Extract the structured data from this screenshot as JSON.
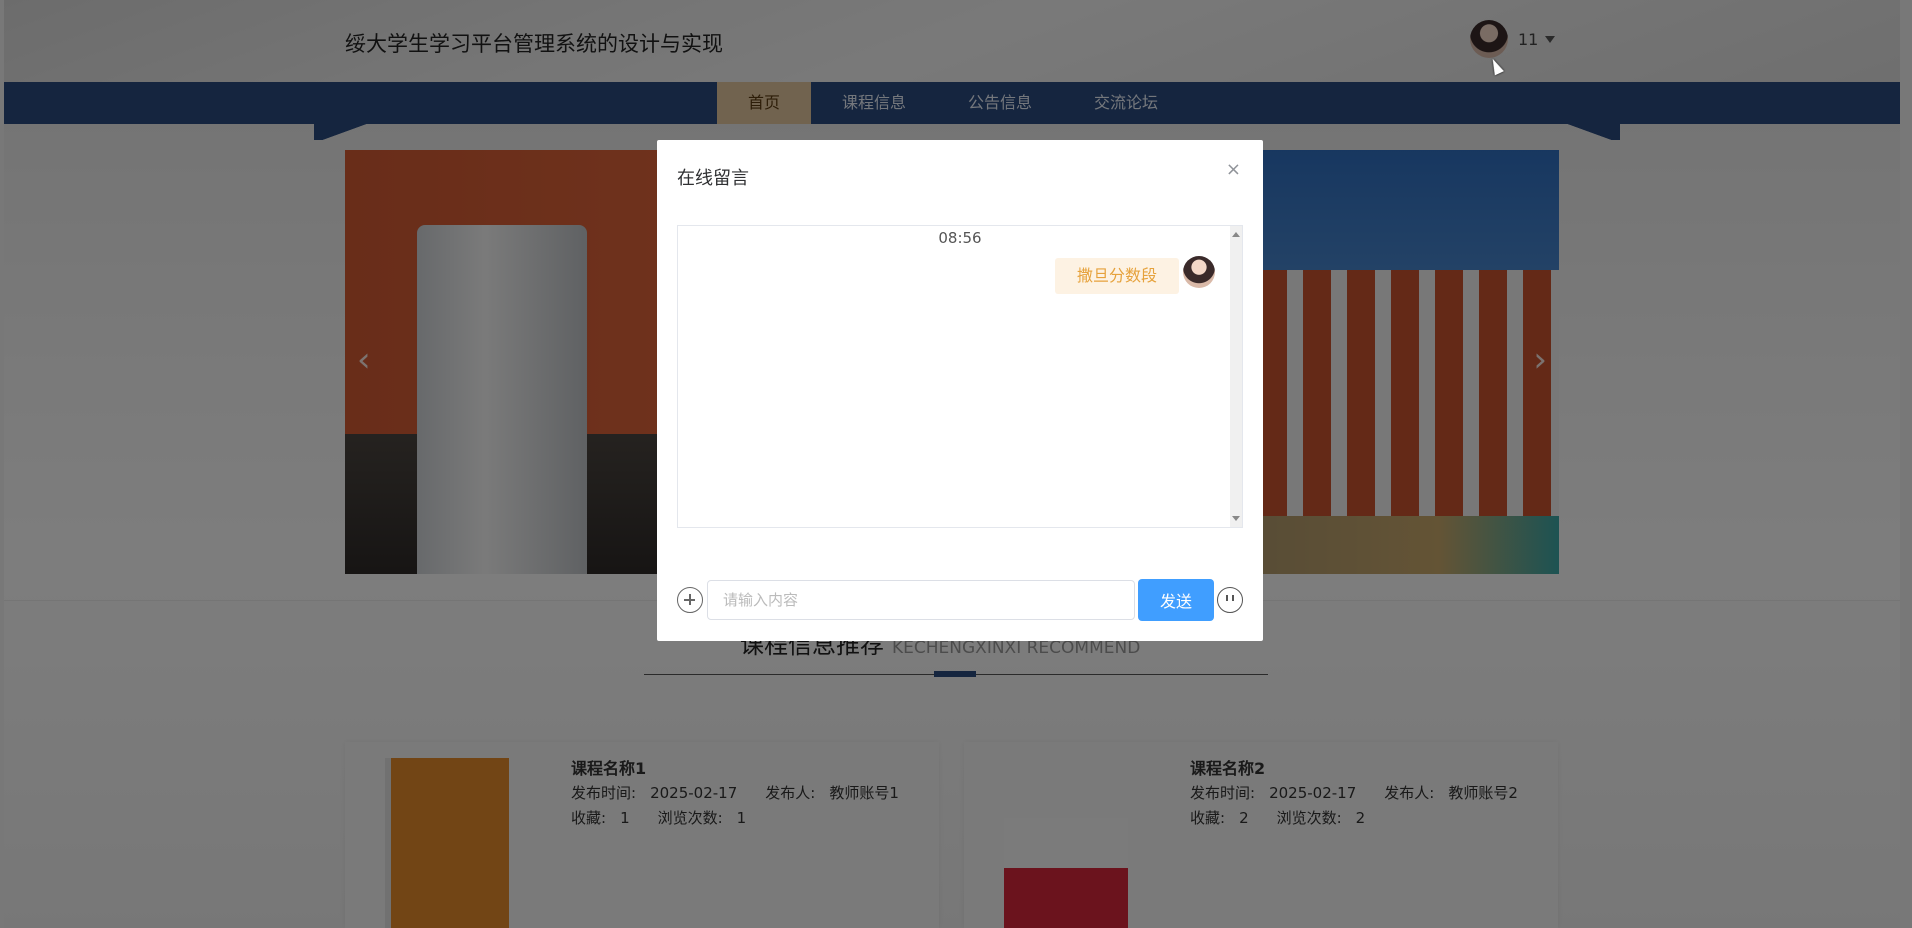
{
  "header": {
    "site_title": "绥大学生学习平台管理系统的设计与实现",
    "user_name": "11",
    "avatar_icon": "avatar-icon",
    "dropdown_icon": "caret-down-icon"
  },
  "nav": {
    "items": [
      {
        "label": "首页",
        "active": true
      },
      {
        "label": "课程信息",
        "active": false
      },
      {
        "label": "公告信息",
        "active": false
      },
      {
        "label": "交流论坛",
        "active": false
      }
    ]
  },
  "carousel": {
    "prev_icon": "chevron-left-icon",
    "next_icon": "chevron-right-icon",
    "prev_glyph": "‹",
    "next_glyph": "›"
  },
  "section": {
    "title": "课程信息推荐",
    "subtitle_en": "KECHENGXINXI RECOMMEND"
  },
  "courses": [
    {
      "name": "课程名称1",
      "publish_label": "发布时间:",
      "publish_time": "2025-02-17",
      "publisher_label": "发布人:",
      "publisher": "教师账号1",
      "fav_label": "收藏:",
      "fav": "1",
      "views_label": "浏览次数:",
      "views": "1"
    },
    {
      "name": "课程名称2",
      "publish_label": "发布时间:",
      "publish_time": "2025-02-17",
      "publisher_label": "发布人:",
      "publisher": "教师账号2",
      "fav_label": "收藏:",
      "fav": "2",
      "views_label": "浏览次数:",
      "views": "2"
    }
  ],
  "modal": {
    "title": "在线留言",
    "close_glyph": "×",
    "chat_time": "08:56",
    "messages": [
      {
        "text": "撒旦分数段",
        "from_self": true
      }
    ],
    "input_placeholder": "请输入内容",
    "input_value": "",
    "send_label": "发送",
    "attach_icon": "plus-circle-icon",
    "emoji_icon": "emoji-icon"
  },
  "colors": {
    "nav_bg": "#2b4a7e",
    "nav_active_bg": "#e2c79f",
    "send_button": "#409eff",
    "bubble_bg": "#fdf2e3",
    "bubble_text": "#e6a23c"
  }
}
